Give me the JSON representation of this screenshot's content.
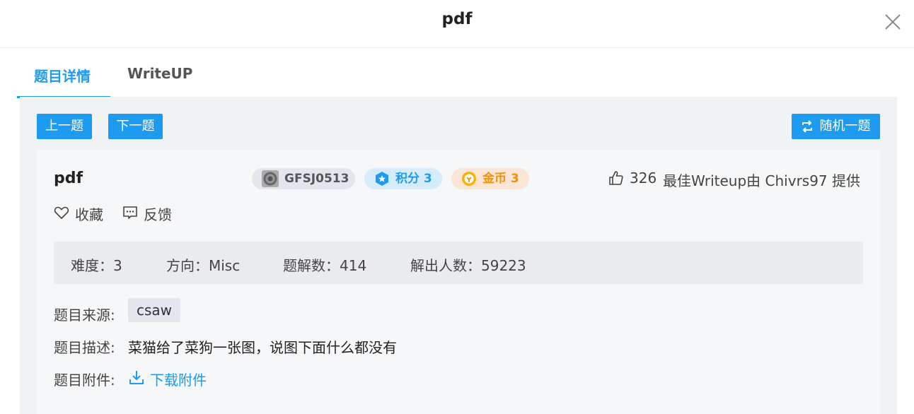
{
  "dialog": {
    "title": "pdf"
  },
  "tabs": [
    {
      "label": "题目详情"
    },
    {
      "label": "WriteUP"
    }
  ],
  "toolbar": {
    "prev_label": "上一题",
    "next_label": "下一题",
    "random_label": "随机一题"
  },
  "challenge": {
    "name": "pdf",
    "author_id": "GFSJ0513",
    "score_label": "积分 3",
    "coin_label": "金币 3",
    "likes": "326",
    "best_writeup": "最佳Writeup由 Chivrs97 提供",
    "favorite_label": "收藏",
    "feedback_label": "反馈",
    "stats": {
      "difficulty": "难度：3",
      "direction": "方向：Misc",
      "solutions": "题解数：414",
      "solvers": "解出人数：59223"
    },
    "source_label": "题目来源:",
    "source_tag": "csaw",
    "description_label": "题目描述:",
    "description": "菜猫给了菜狗一张图，说图下面什么都没有",
    "attachment_label": "题目附件:",
    "download_label": "下载附件"
  },
  "colors": {
    "accent": "#1d9bf0",
    "coin": "#f39200",
    "panel": "#f1f2f4"
  },
  "icons": [
    "close-icon",
    "shuffle-icon",
    "star-icon",
    "coin-icon",
    "thumbs-up-icon",
    "heart-icon",
    "feedback-icon",
    "download-icon"
  ]
}
